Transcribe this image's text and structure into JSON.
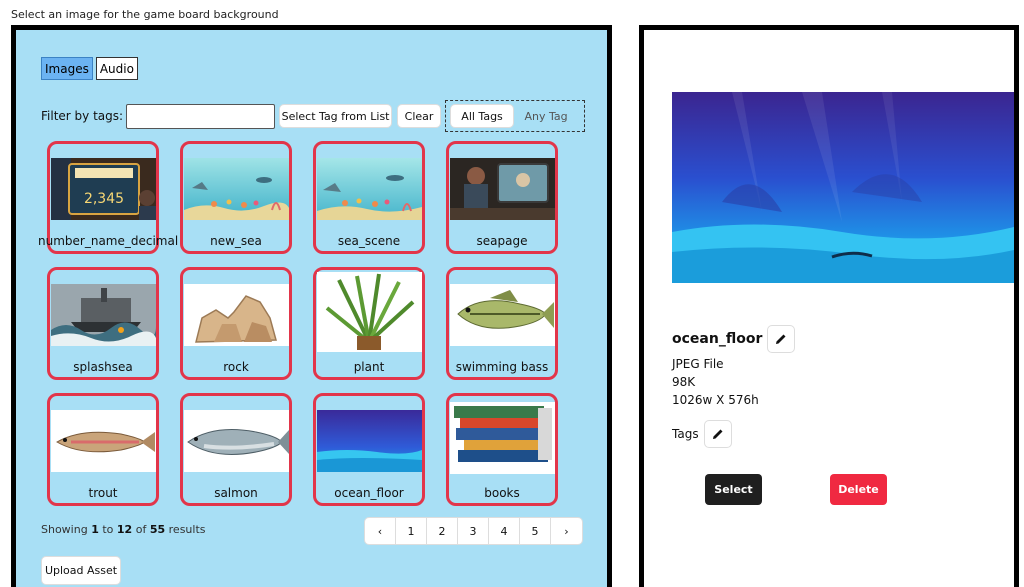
{
  "page_title": "Select an image for the game board background",
  "type_tabs": [
    {
      "label": "Images",
      "active": true
    },
    {
      "label": "Audio",
      "active": false
    }
  ],
  "filter": {
    "label": "Filter by tags:",
    "input_value": "",
    "select_tag_label": "Select Tag from List",
    "clear_label": "Clear",
    "modes": [
      {
        "label": "All Tags",
        "active": true
      },
      {
        "label": "Any Tag",
        "active": false
      }
    ]
  },
  "assets": [
    {
      "name": "number_name_decimal",
      "icon": "game-show-screen-thumbnail"
    },
    {
      "name": "new_sea",
      "icon": "underwater-fish-thumbnail"
    },
    {
      "name": "sea_scene",
      "icon": "underwater-fish-thumbnail"
    },
    {
      "name": "seapage",
      "icon": "pilot-cockpit-thumbnail"
    },
    {
      "name": "splashsea",
      "icon": "ship-storm-thumbnail"
    },
    {
      "name": "rock",
      "icon": "rock-thumbnail"
    },
    {
      "name": "plant",
      "icon": "plant-thumbnail"
    },
    {
      "name": "swimming bass",
      "icon": "bass-fish-thumbnail"
    },
    {
      "name": "trout",
      "icon": "trout-fish-thumbnail"
    },
    {
      "name": "salmon",
      "icon": "salmon-fish-thumbnail"
    },
    {
      "name": "ocean_floor",
      "icon": "ocean-floor-thumbnail"
    },
    {
      "name": "books",
      "icon": "books-stack-thumbnail"
    }
  ],
  "results": {
    "prefix": "Showing",
    "from": "1",
    "to_word": "to",
    "to": "12",
    "of_word": "of",
    "total": "55",
    "suffix": "results"
  },
  "pagination": {
    "prev": "‹",
    "pages": [
      "1",
      "2",
      "3",
      "4",
      "5"
    ],
    "next": "›"
  },
  "upload_label": "Upload Asset",
  "selected": {
    "name": "ocean_floor",
    "file_type": "JPEG File",
    "size": "98K",
    "dimensions": "1026w X 576h",
    "tags_label": "Tags",
    "select_label": "Select",
    "delete_label": "Delete"
  },
  "colors": {
    "panel_bg": "#a8dff5",
    "tile_border": "#e2354a",
    "active_tab": "#6bb3f2",
    "delete_bg": "#f02941",
    "select_bg": "#1f1f1f"
  }
}
